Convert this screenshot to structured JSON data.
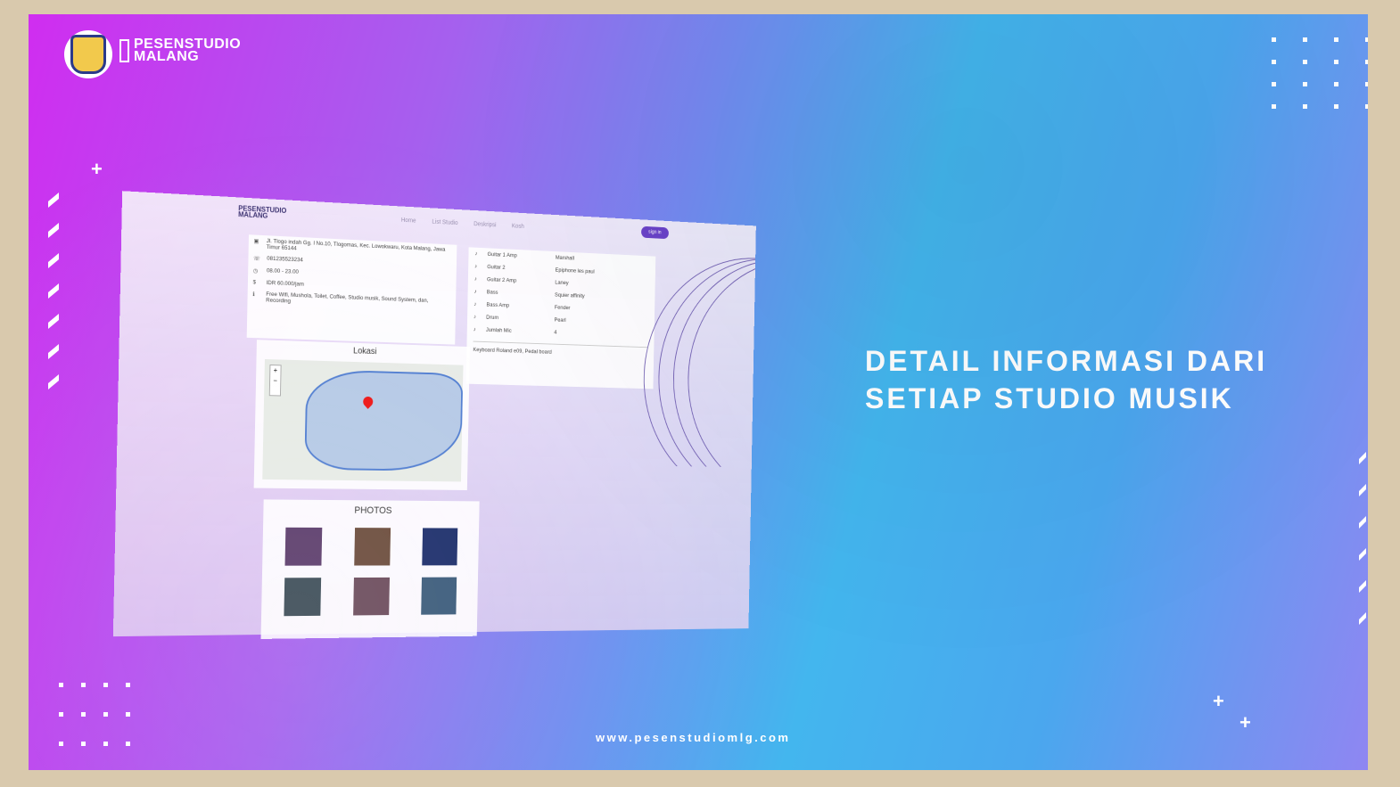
{
  "brand": {
    "line1": "PESENSTUDIO",
    "line2": "MALANG"
  },
  "headline": {
    "line1": "DETAIL INFORMASI DARI",
    "line2": "SETIAP STUDIO MUSIK"
  },
  "website": "www.pesenstudiomlg.com",
  "screenshot": {
    "nav": {
      "logo_line1": "PESENSTUDIO",
      "logo_line2": "MALANG",
      "links": [
        "Home",
        "List Studio",
        "Deskripsi",
        "Kosh"
      ],
      "signin": "sign in"
    },
    "info": {
      "address": "Jl. Tlogo indah Gg. I No.10, Tlogomas, Kec. Lowokwaru, Kota Malang, Jawa Timur 65144",
      "phone": "081235523234",
      "hours": "08.00 - 23.00",
      "price": "IDR 60.000/jam",
      "facilities": "Free Wifi, Mushola, Toilet, Coffee, Studio musik, Sound System, dan, Recording"
    },
    "location_title": "Lokasi",
    "photos_title": "PHOTOS",
    "photo_colors": [
      "#5a3a6a",
      "#6a4a3a",
      "#1a2c6a",
      "#3a4a55",
      "#6a4a5a",
      "#3a5a7a"
    ],
    "equipment": [
      {
        "name": "Guitar 1 Amp",
        "value": "Marshall"
      },
      {
        "name": "Guitar 2",
        "value": "Epiphone les paul"
      },
      {
        "name": "Guitar 2 Amp",
        "value": "Laney"
      },
      {
        "name": "Bass",
        "value": "Squier affinity"
      },
      {
        "name": "Bass Amp",
        "value": "Fender"
      },
      {
        "name": "Drum",
        "value": "Pearl"
      },
      {
        "name": "Jumlah Mic",
        "value": "4"
      }
    ],
    "equipment_extra": "Keyboard Roland e09, Pedal board"
  }
}
